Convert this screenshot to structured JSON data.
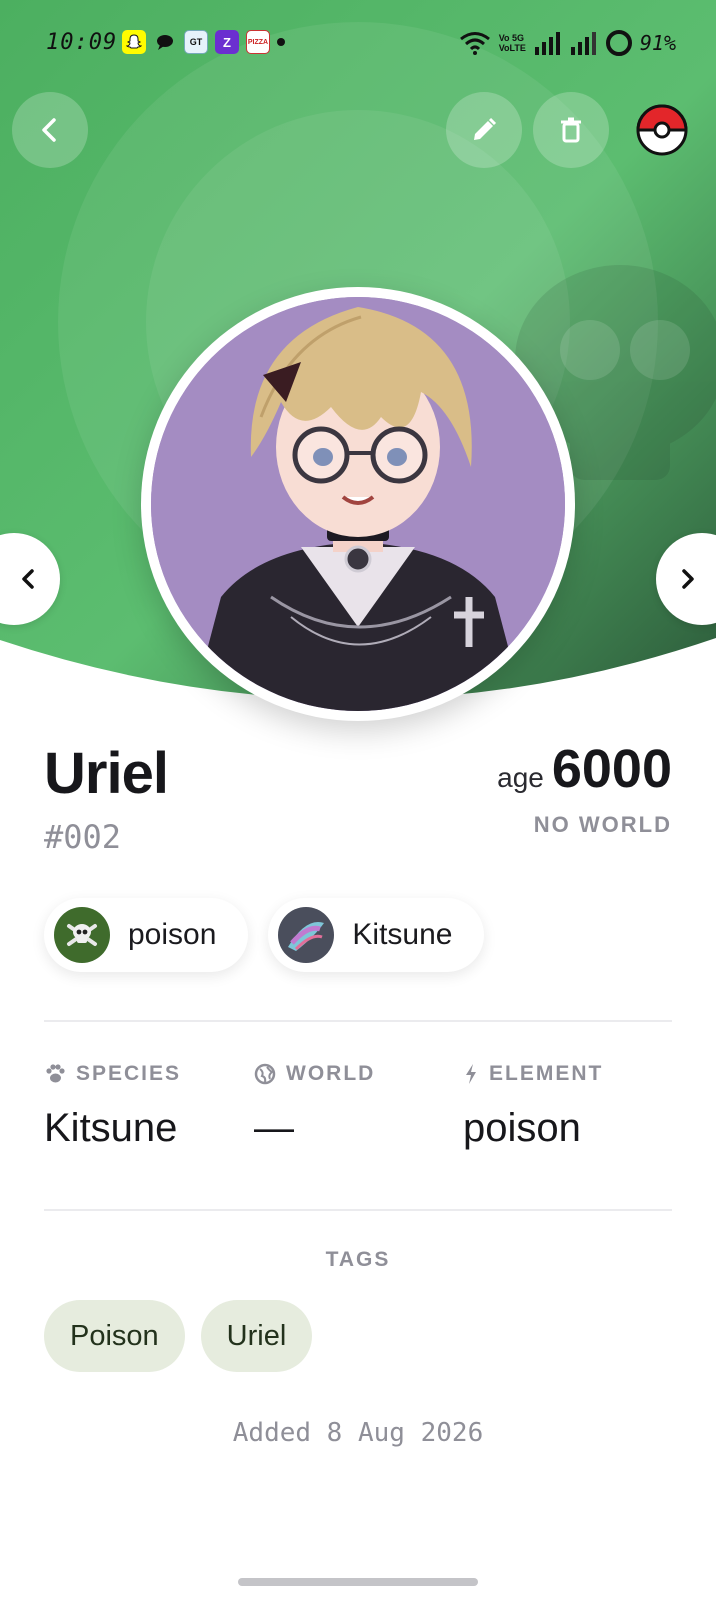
{
  "status_bar": {
    "time": "10:09",
    "notifications": [
      "snapchat-icon",
      "chat-icon",
      "gt-icon",
      "z-icon",
      "pizza-icon"
    ],
    "volte": "Vo 5G\nVoLTE",
    "battery": "91%"
  },
  "header": {
    "back_icon": "chevron-left-icon",
    "edit_icon": "pencil-icon",
    "delete_icon": "trash-icon",
    "pokeball_icon": "pokeball-icon"
  },
  "colors": {
    "hero_green": "#52b768",
    "hero_dark": "#2f5b3c",
    "tag_bg": "#e6ecde"
  },
  "character": {
    "name": "Uriel",
    "number": "#002",
    "age_label": "age",
    "age": "6000",
    "world_caption": "NO WORLD"
  },
  "chips": [
    {
      "label": "poison",
      "icon": "skull-crossbones-icon"
    },
    {
      "label": "Kitsune",
      "icon": "kitsune-icon"
    }
  ],
  "stats": {
    "species": {
      "label": "SPECIES",
      "value": "Kitsune",
      "icon": "paw-icon"
    },
    "world": {
      "label": "WORLD",
      "value": "—",
      "icon": "globe-icon"
    },
    "element": {
      "label": "ELEMENT",
      "value": "poison",
      "icon": "bolt-icon"
    }
  },
  "tags": {
    "title": "TAGS",
    "items": [
      "Poison",
      "Uriel"
    ]
  },
  "footer": {
    "added": "Added 8 Aug 2026"
  }
}
